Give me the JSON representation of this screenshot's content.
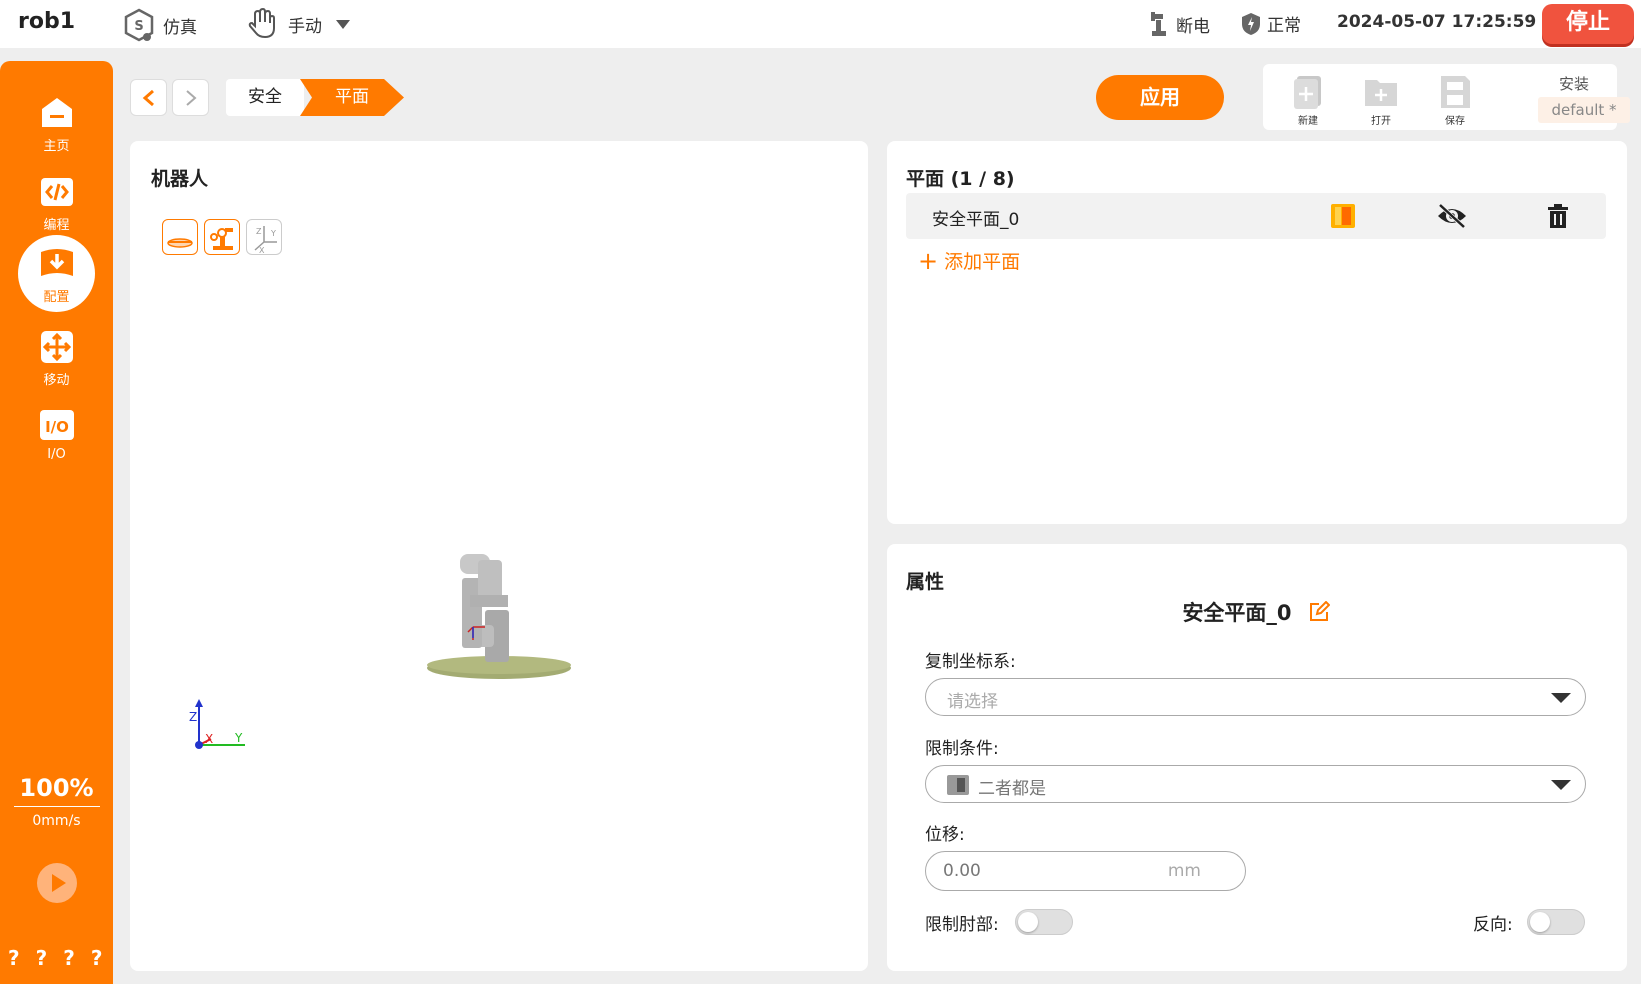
{
  "header": {
    "robot_name": "rob1",
    "sim_label": "仿真",
    "mode_label": "手动",
    "power_label": "断电",
    "status_label": "正常",
    "datetime": "2024-05-07 17:25:59",
    "stop_label": "停止"
  },
  "sidebar": {
    "items": [
      {
        "label": "主页",
        "icon": "home-icon"
      },
      {
        "label": "编程",
        "icon": "code-icon"
      },
      {
        "label": "配置",
        "icon": "config-icon"
      },
      {
        "label": "移动",
        "icon": "move-icon"
      },
      {
        "label": "I/O",
        "icon": "io-icon"
      }
    ],
    "speed_percent": "100%",
    "speed_value": "0mm/s",
    "help_marks": [
      "?",
      "?",
      "?",
      "?"
    ]
  },
  "breadcrumb": [
    "安全",
    "平面"
  ],
  "toolbar": {
    "apply_label": "应用",
    "new_label": "新建",
    "open_label": "打开",
    "save_label": "保存",
    "install_label": "安装",
    "install_value": "default *"
  },
  "robot_panel": {
    "title": "机器人",
    "axis_z": "Z",
    "axis_x": "X",
    "axis_y": "Y"
  },
  "planes_panel": {
    "title": "平面  (1 / 8)",
    "items": [
      {
        "name": "安全平面_0"
      }
    ],
    "add_label": "添加平面"
  },
  "properties": {
    "title": "属性",
    "plane_name": "安全平面_0",
    "copy_frame_label": "复制坐标系:",
    "copy_frame_placeholder": "请选择",
    "restriction_label": "限制条件:",
    "restriction_value": "二者都是",
    "offset_label": "位移:",
    "offset_value": "0.00",
    "offset_unit": "mm",
    "limit_elbow_label": "限制肘部:",
    "reverse_label": "反向:"
  },
  "colors": {
    "accent": "#ff7a00",
    "stop": "#f0533e",
    "base_disc": "#a3ab72"
  }
}
